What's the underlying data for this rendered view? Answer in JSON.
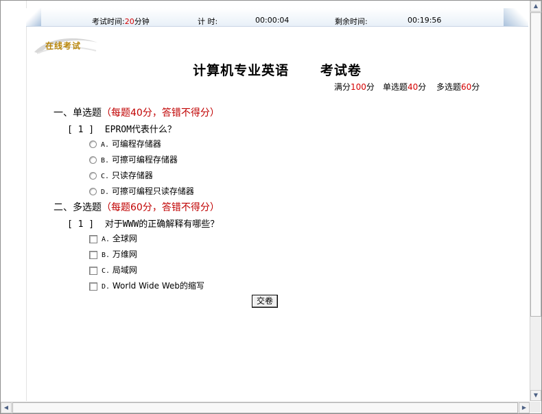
{
  "header": {
    "exam_time_label": "考试时间:",
    "exam_time_value": "20",
    "exam_time_unit": "分钟",
    "timer_label": "计 时:",
    "timer_value": "00:00:04",
    "remaining_label": "剩余时间:",
    "remaining_value": "00:19:56"
  },
  "logo_text": "在线考试",
  "title": "计算机专业英语      考试卷",
  "score": {
    "total_label": "满分",
    "total_value": "100",
    "total_unit": "分",
    "single_label": "单选题",
    "single_value": "40",
    "single_unit": "分",
    "multi_label": "多选题",
    "multi_value": "60",
    "multi_unit": "分"
  },
  "sections": [
    {
      "heading": "一、单选题",
      "note": "（每题40分，答错不得分）",
      "question_number": "[ 1 ]",
      "question_text": "EPROM代表什么？",
      "options": [
        {
          "letter": "A.",
          "text": "可编程存储器"
        },
        {
          "letter": "B.",
          "text": "可擦可编程存储器"
        },
        {
          "letter": "C.",
          "text": "只读存储器"
        },
        {
          "letter": "D.",
          "text": "可擦可编程只读存储器"
        }
      ]
    },
    {
      "heading": "二、多选题",
      "note": "（每题60分，答错不得分）",
      "question_number": "[ 1 ]",
      "question_text": "对于WWW的正确解释有哪些？",
      "options": [
        {
          "letter": "A.",
          "text": "全球网"
        },
        {
          "letter": "B.",
          "text": "万维网"
        },
        {
          "letter": "C.",
          "text": "局域网"
        },
        {
          "letter": "D.",
          "text": "World Wide Web的缩写"
        }
      ]
    }
  ],
  "submit_label": "交卷",
  "colors": {
    "accent_red": "#d40000",
    "note_red": "#c00000",
    "logo_gold": "#b8860b"
  },
  "icons": {
    "scroll_up": "▲",
    "scroll_down": "▼",
    "scroll_left": "◀",
    "scroll_right": "▶"
  }
}
